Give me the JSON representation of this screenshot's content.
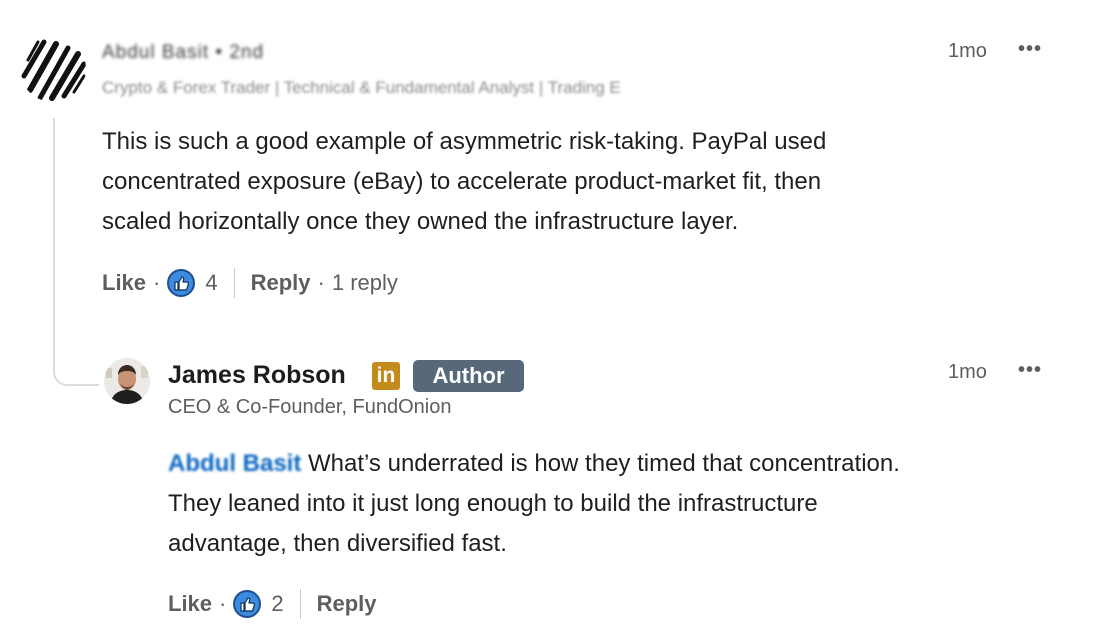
{
  "top_comment": {
    "author_name": "Abdul Basit • 2nd",
    "author_headline": "Crypto & Forex Trader | Technical & Fundamental Analyst | Trading E",
    "time": "1mo",
    "more_label": "•••",
    "body_lines": [
      "This is such a good example of asymmetric risk-taking. PayPal used",
      "concentrated exposure (eBay) to accelerate product-market fit, then",
      "scaled horizontally once they owned the infrastructure layer."
    ],
    "actions": {
      "like_label": "Like",
      "dot": "·",
      "reaction_count": "4",
      "reply_label": "Reply",
      "replies_label": "1 reply"
    }
  },
  "reply": {
    "author_name": "James Robson",
    "linkedin_badge": "in",
    "author_badge": "Author",
    "author_headline": "CEO & Co-Founder, FundOnion",
    "time": "1mo",
    "more_label": "•••",
    "mention": "Abdul Basit",
    "body_lines": [
      "What’s underrated is how they timed that concentration.",
      "They leaned into it just long enough to build the infrastructure",
      "advantage, then diversified fast."
    ],
    "actions": {
      "like_label": "Like",
      "dot": "·",
      "reaction_count": "2",
      "reply_label": "Reply"
    }
  },
  "colors": {
    "mention": "#0a66c2",
    "like_icon": "#3d8be0",
    "author_badge": "#56687a",
    "linkedin_badge": "#c58a1c"
  },
  "icons": {
    "like": "thumbs-up-icon",
    "more": "more-options-icon"
  }
}
